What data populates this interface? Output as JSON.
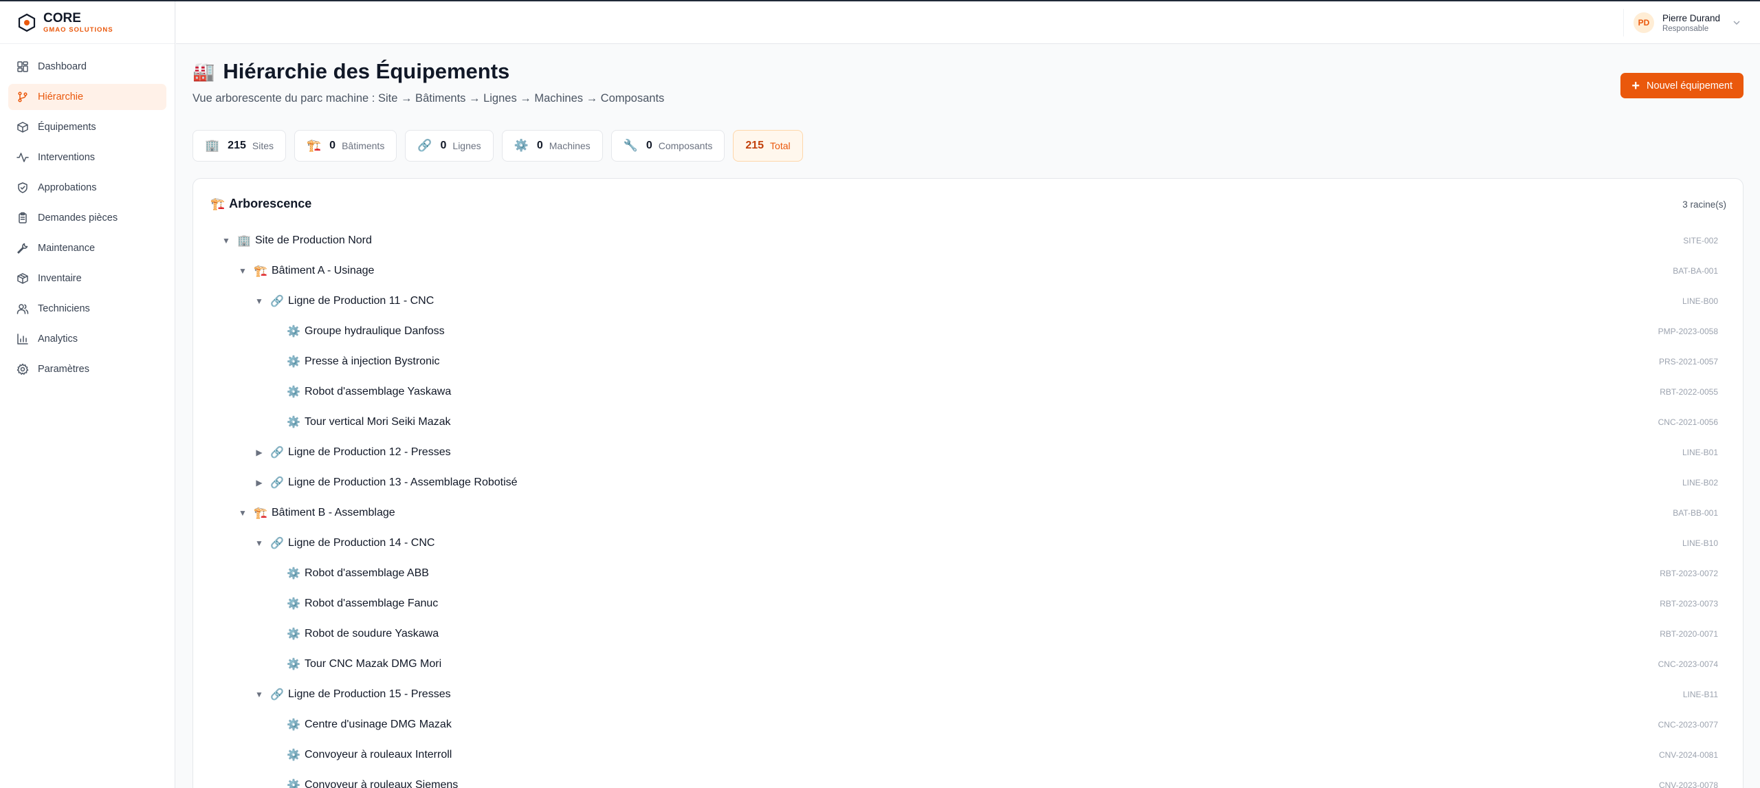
{
  "brand": {
    "name": "CORE",
    "sub": "GMAO SOLUTIONS"
  },
  "sidebar": {
    "items": [
      {
        "label": "Dashboard",
        "icon": "grid-icon",
        "active": false
      },
      {
        "label": "Hiérarchie",
        "icon": "branch-icon",
        "active": true
      },
      {
        "label": "Équipements",
        "icon": "box-icon",
        "active": false
      },
      {
        "label": "Interventions",
        "icon": "activity-icon",
        "active": false
      },
      {
        "label": "Approbations",
        "icon": "shield-check-icon",
        "active": false
      },
      {
        "label": "Demandes pièces",
        "icon": "clipboard-icon",
        "active": false
      },
      {
        "label": "Maintenance",
        "icon": "wrench-icon",
        "active": false
      },
      {
        "label": "Inventaire",
        "icon": "package-icon",
        "active": false
      },
      {
        "label": "Techniciens",
        "icon": "users-icon",
        "active": false
      },
      {
        "label": "Analytics",
        "icon": "bar-chart-icon",
        "active": false
      },
      {
        "label": "Paramètres",
        "icon": "gear-icon",
        "active": false
      }
    ]
  },
  "user": {
    "initials": "PD",
    "name": "Pierre Durand",
    "role": "Responsable"
  },
  "page": {
    "title_emoji": "🏭",
    "title": "Hiérarchie des Équipements",
    "subtitle": "Vue arborescente du parc machine : Site → Bâtiments → Lignes → Machines → Composants",
    "new_button": "Nouvel équipement"
  },
  "stats": [
    {
      "icon": "🏢",
      "value": "215",
      "label": "Sites"
    },
    {
      "icon": "🏗️",
      "value": "0",
      "label": "Bâtiments"
    },
    {
      "icon": "🔗",
      "value": "0",
      "label": "Lignes"
    },
    {
      "icon": "⚙️",
      "value": "0",
      "label": "Machines"
    },
    {
      "icon": "🔧",
      "value": "0",
      "label": "Composants"
    },
    {
      "icon": "",
      "value": "215",
      "label": "Total"
    }
  ],
  "tree": {
    "title_icon": "🏗️",
    "title": "Arborescence",
    "count": "3 racine(s)",
    "rows": [
      {
        "level": 0,
        "toggle": "▼",
        "icon": "🏢",
        "name": "Site de Production Nord",
        "code": "SITE-002"
      },
      {
        "level": 1,
        "toggle": "▼",
        "icon": "🏗️",
        "name": "Bâtiment A - Usinage",
        "code": "BAT-BA-001"
      },
      {
        "level": 2,
        "toggle": "▼",
        "icon": "🔗",
        "name": "Ligne de Production 11 - CNC",
        "code": "LINE-B00"
      },
      {
        "level": 3,
        "toggle": "",
        "icon": "⚙️",
        "name": "Groupe hydraulique Danfoss",
        "code": "PMP-2023-0058"
      },
      {
        "level": 3,
        "toggle": "",
        "icon": "⚙️",
        "name": "Presse à injection Bystronic",
        "code": "PRS-2021-0057"
      },
      {
        "level": 3,
        "toggle": "",
        "icon": "⚙️",
        "name": "Robot d'assemblage Yaskawa",
        "code": "RBT-2022-0055"
      },
      {
        "level": 3,
        "toggle": "",
        "icon": "⚙️",
        "name": "Tour vertical Mori Seiki Mazak",
        "code": "CNC-2021-0056"
      },
      {
        "level": 2,
        "toggle": "▶",
        "icon": "🔗",
        "name": "Ligne de Production 12 - Presses",
        "code": "LINE-B01"
      },
      {
        "level": 2,
        "toggle": "▶",
        "icon": "🔗",
        "name": "Ligne de Production 13 - Assemblage Robotisé",
        "code": "LINE-B02"
      },
      {
        "level": 1,
        "toggle": "▼",
        "icon": "🏗️",
        "name": "Bâtiment B - Assemblage",
        "code": "BAT-BB-001"
      },
      {
        "level": 2,
        "toggle": "▼",
        "icon": "🔗",
        "name": "Ligne de Production 14 - CNC",
        "code": "LINE-B10"
      },
      {
        "level": 3,
        "toggle": "",
        "icon": "⚙️",
        "name": "Robot d'assemblage ABB",
        "code": "RBT-2023-0072"
      },
      {
        "level": 3,
        "toggle": "",
        "icon": "⚙️",
        "name": "Robot d'assemblage Fanuc",
        "code": "RBT-2023-0073"
      },
      {
        "level": 3,
        "toggle": "",
        "icon": "⚙️",
        "name": "Robot de soudure Yaskawa",
        "code": "RBT-2020-0071"
      },
      {
        "level": 3,
        "toggle": "",
        "icon": "⚙️",
        "name": "Tour CNC Mazak DMG Mori",
        "code": "CNC-2023-0074"
      },
      {
        "level": 2,
        "toggle": "▼",
        "icon": "🔗",
        "name": "Ligne de Production 15 - Presses",
        "code": "LINE-B11"
      },
      {
        "level": 3,
        "toggle": "",
        "icon": "⚙️",
        "name": "Centre d'usinage DMG Mazak",
        "code": "CNC-2023-0077"
      },
      {
        "level": 3,
        "toggle": "",
        "icon": "⚙️",
        "name": "Convoyeur à rouleaux Interroll",
        "code": "CNV-2024-0081"
      },
      {
        "level": 3,
        "toggle": "",
        "icon": "⚙️",
        "name": "Convoyeur à rouleaux Siemens",
        "code": "CNV-2023-0078"
      }
    ]
  },
  "colors": {
    "accent": "#ea580c",
    "accent_soft": "#fff1e8"
  }
}
